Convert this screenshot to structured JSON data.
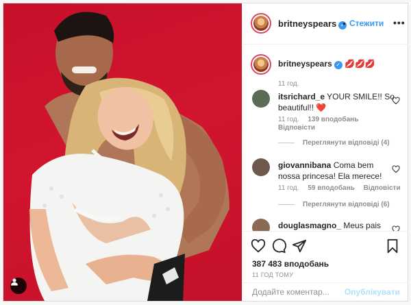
{
  "post": {
    "author": "britneyspears",
    "follow_label": "Стежити",
    "more_label": "•••",
    "caption_emoji": "💋💋💋",
    "caption_time": "11 год."
  },
  "comments": [
    {
      "user": "itsrichard_e",
      "text": "YOUR SMILE!! So beautiful!!",
      "emoji": "❤️",
      "time": "11 год.",
      "likes": "139 вподобань",
      "reply": "Відповісти",
      "view_replies": "Переглянути відповіді (4)"
    },
    {
      "user": "giovannibana",
      "text": "Coma bem nossa princesa! Ela merece!",
      "time": "11 год.",
      "likes": "59 вподобань",
      "reply": "Відповісти",
      "view_replies": "Переглянути відповіді (6)"
    },
    {
      "user": "douglasmagno_",
      "text": "Meus pais são"
    }
  ],
  "footer": {
    "likes": "387 483 вподобань",
    "time": "11 ГОД ТОМУ",
    "comment_placeholder": "Додайте коментар...",
    "publish_label": "Опублікувати"
  },
  "icons": {
    "verified": "verified-badge-icon",
    "heart": "heart-icon",
    "comment": "comment-icon",
    "share": "share-icon",
    "save": "bookmark-icon",
    "tag": "user-tag-icon"
  },
  "colors": {
    "accent": "#3897f0",
    "publish_disabled": "#b2dffc",
    "background_red": "#c7102a"
  }
}
